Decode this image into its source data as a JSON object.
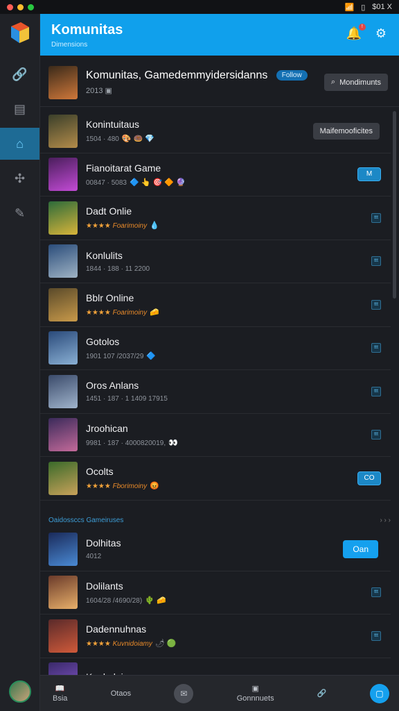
{
  "status": {
    "right_text": "$01 X"
  },
  "header": {
    "title": "Komunitas",
    "subtitle": "Dimensions"
  },
  "featured": {
    "title": "Komunitas, Gamedemmyidersidanns",
    "meta": "2013",
    "pill": "Follow",
    "button": "Mondimunts"
  },
  "games": [
    {
      "name": "Konintuitaus",
      "sub": "1504 · 480",
      "emojis": "🎨 🍩 💎",
      "action": "Maifemooficites",
      "thumb": [
        "#3a3f2a",
        "#b48c4a"
      ]
    },
    {
      "name": "Fianoitarat Game",
      "sub": "00847 · 5083",
      "emojis": "🔷 👆 🎯 🔶 🔮",
      "action": "M",
      "thumb": [
        "#4a1e5c",
        "#c34bd6"
      ]
    },
    {
      "name": "Dadt Onlie",
      "stars": "★★★★",
      "tag": "Foarimoiny",
      "emojis": "💧",
      "action": "ttt",
      "thumb": [
        "#2d6b3a",
        "#d8b43a"
      ]
    },
    {
      "name": "Konlulits",
      "sub": "1844 · 188 · 11 2200",
      "action": "ttt",
      "thumb": [
        "#2a4c7a",
        "#9fb3c4"
      ]
    },
    {
      "name": "Bblr Online",
      "stars": "★★★★",
      "tag": "Foarimoiny",
      "emojis": "🧀",
      "action": "ttt",
      "thumb": [
        "#5a4a2a",
        "#c99a4a"
      ]
    },
    {
      "name": "Gotolos",
      "sub": "1901 107 /2037/29",
      "emojis": "🔷",
      "action": "ttt",
      "thumb": [
        "#2a4a7a",
        "#8ab0d4"
      ]
    },
    {
      "name": "Oros Anlans",
      "sub": "1451 · 187 · 1 1409 17915",
      "action": "ttt",
      "thumb": [
        "#3a4a6a",
        "#a0b4cc"
      ]
    },
    {
      "name": "Jroohican",
      "sub": "9981 · 187 · 4000820019,",
      "emojis": "👀",
      "action": "ttt",
      "thumb": [
        "#3a2a5a",
        "#c46a9a"
      ]
    },
    {
      "name": "Ocolts",
      "stars": "★★★★",
      "tag": "Fborimoiny",
      "emojis": "😡",
      "action": "CO",
      "thumb": [
        "#3a6a2a",
        "#c9a25a"
      ]
    }
  ],
  "section": {
    "title": "Oaidossccs Gameiruses",
    "more": "› › ›"
  },
  "games2": [
    {
      "name": "Dolhitas",
      "sub": "4012",
      "action": "Oan",
      "thumb": [
        "#1a2a5a",
        "#4a8ad4"
      ]
    },
    {
      "name": "Dolilants",
      "sub": "1604/28 /4690/28)",
      "emojis": "🌵 🧀",
      "action": "ttt",
      "thumb": [
        "#6a3a2a",
        "#e8b06a"
      ]
    },
    {
      "name": "Dadennuhnas",
      "stars": "★★★★",
      "tag": "Kuvnidoiamy",
      "emojis": "🌶 🟢",
      "action": "ttt",
      "thumb": [
        "#5a2a2a",
        "#d05a3a"
      ]
    },
    {
      "name": "Konkulnies",
      "sub": "",
      "action": "",
      "thumb": [
        "#3a2a6a",
        "#8a5ad4"
      ]
    }
  ],
  "bottom": {
    "item1": "Bsia",
    "item2": "Otaos",
    "item3": "Gonnnuets"
  },
  "colors": {
    "accent": "#10a0ec",
    "bg": "#1b1d22"
  }
}
